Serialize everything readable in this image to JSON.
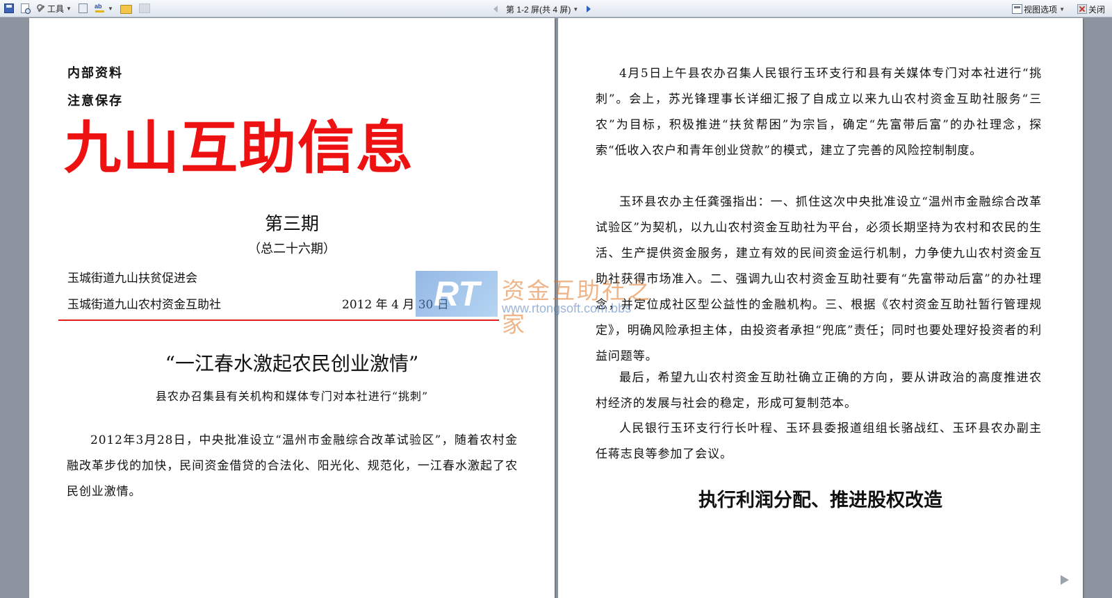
{
  "toolbar": {
    "tools_label": "工具",
    "page_indicator": "第 1-2 屏(共 4 屏)",
    "view_options_label": "视图选项",
    "close_label": "关闭",
    "icons": [
      "save-icon",
      "print-preview-icon",
      "tools-icon",
      "research-icon",
      "spelling-icon",
      "folder-icon",
      "track-changes-icon",
      "prev-screen-icon",
      "next-screen-icon",
      "view-options-icon",
      "close-icon"
    ]
  },
  "left_page": {
    "notice_1": "内部资料",
    "notice_2": "注意保存",
    "masthead": "九山互助信息",
    "issue": "第三期",
    "total_issue": "（总二十六期）",
    "org_1": "玉城街道九山扶贫促进会",
    "org_2": "玉城街道九山农村资金互助社",
    "date": "2012 年 4 月 30 日",
    "headline": "“一江春水激起农民创业激情”",
    "subheadline": "县农办召集县有关机构和媒体专门对本社进行“挑刺”",
    "paragraph": "2012年3月28日，中央批准设立“温州市金融综合改革试验区”，随着农村金融改革步伐的加快，民间资金借贷的合法化、阳光化、规范化，一江春水激起了农民创业激情。"
  },
  "right_page": {
    "paragraph_1": "4月5日上午县农办召集人民银行玉环支行和县有关媒体专门对本社进行“挑刺”。会上，苏光锋理事长详细汇报了自成立以来九山农村资金互助社服务“三农”为目标，积极推进“扶贫帮困”为宗旨，确定“先富带后富”的办社理念，探索“低收入农户和青年创业贷款”的模式，建立了完善的风险控制制度。",
    "paragraph_2": "玉环县农办主任龚强指出：一、抓住这次中央批准设立“温州市金融综合改革试验区”为契机，以九山农村资金互助社为平台，必须长期坚持为农村和农民的生活、生产提供资金服务，建立有效的民间资金运行机制，力争使九山农村资金互助社获得市场准入。二、强调九山农村资金互助社要有“先富带动后富”的办社理念，并定位成社区型公益性的金融机构。三、根据《农村资金互助社暂行管理规定》，明确风险承担主体，由投资者承担“兜底”责任；同时也要处理好投资者的利益问题等。",
    "paragraph_3": "最后，希望九山农村资金互助社确立正确的方向，要从讲政治的高度推进农村经济的发展与社会的稳定，形成可复制范本。",
    "paragraph_4": "人民银行玉环支行行长叶程、玉环县委报道组组长骆战红、玉环县农办副主任蒋志良等参加了会议。",
    "heading": "执行利润分配、推进股权改造"
  },
  "watermark": {
    "logo_text": "RT",
    "title": "资金互助社之家",
    "url": "www.rtongsoft.com.bbs"
  },
  "colors": {
    "masthead": "#ee1111",
    "rule": "#e21b1b",
    "workspace": "#8c94a0"
  }
}
